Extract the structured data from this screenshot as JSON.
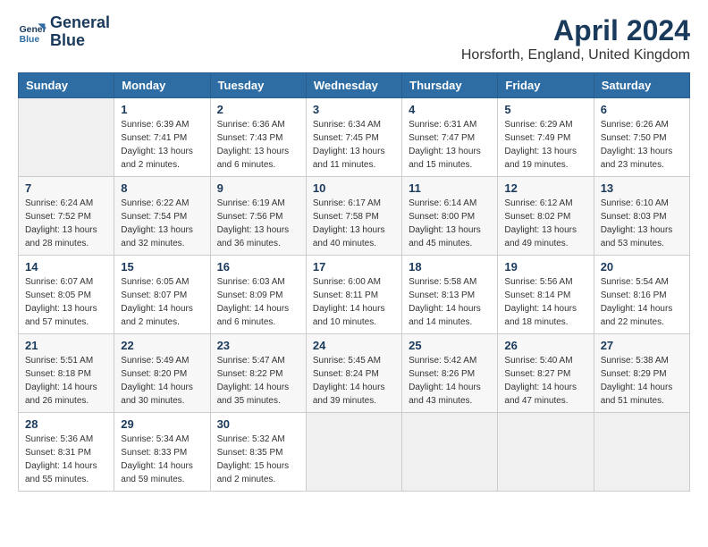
{
  "logo": {
    "line1": "General",
    "line2": "Blue"
  },
  "title": "April 2024",
  "subtitle": "Horsforth, England, United Kingdom",
  "weekdays": [
    "Sunday",
    "Monday",
    "Tuesday",
    "Wednesday",
    "Thursday",
    "Friday",
    "Saturday"
  ],
  "weeks": [
    [
      {
        "day": "",
        "sunrise": "",
        "sunset": "",
        "daylight": ""
      },
      {
        "day": "1",
        "sunrise": "Sunrise: 6:39 AM",
        "sunset": "Sunset: 7:41 PM",
        "daylight": "Daylight: 13 hours and 2 minutes."
      },
      {
        "day": "2",
        "sunrise": "Sunrise: 6:36 AM",
        "sunset": "Sunset: 7:43 PM",
        "daylight": "Daylight: 13 hours and 6 minutes."
      },
      {
        "day": "3",
        "sunrise": "Sunrise: 6:34 AM",
        "sunset": "Sunset: 7:45 PM",
        "daylight": "Daylight: 13 hours and 11 minutes."
      },
      {
        "day": "4",
        "sunrise": "Sunrise: 6:31 AM",
        "sunset": "Sunset: 7:47 PM",
        "daylight": "Daylight: 13 hours and 15 minutes."
      },
      {
        "day": "5",
        "sunrise": "Sunrise: 6:29 AM",
        "sunset": "Sunset: 7:49 PM",
        "daylight": "Daylight: 13 hours and 19 minutes."
      },
      {
        "day": "6",
        "sunrise": "Sunrise: 6:26 AM",
        "sunset": "Sunset: 7:50 PM",
        "daylight": "Daylight: 13 hours and 23 minutes."
      }
    ],
    [
      {
        "day": "7",
        "sunrise": "Sunrise: 6:24 AM",
        "sunset": "Sunset: 7:52 PM",
        "daylight": "Daylight: 13 hours and 28 minutes."
      },
      {
        "day": "8",
        "sunrise": "Sunrise: 6:22 AM",
        "sunset": "Sunset: 7:54 PM",
        "daylight": "Daylight: 13 hours and 32 minutes."
      },
      {
        "day": "9",
        "sunrise": "Sunrise: 6:19 AM",
        "sunset": "Sunset: 7:56 PM",
        "daylight": "Daylight: 13 hours and 36 minutes."
      },
      {
        "day": "10",
        "sunrise": "Sunrise: 6:17 AM",
        "sunset": "Sunset: 7:58 PM",
        "daylight": "Daylight: 13 hours and 40 minutes."
      },
      {
        "day": "11",
        "sunrise": "Sunrise: 6:14 AM",
        "sunset": "Sunset: 8:00 PM",
        "daylight": "Daylight: 13 hours and 45 minutes."
      },
      {
        "day": "12",
        "sunrise": "Sunrise: 6:12 AM",
        "sunset": "Sunset: 8:02 PM",
        "daylight": "Daylight: 13 hours and 49 minutes."
      },
      {
        "day": "13",
        "sunrise": "Sunrise: 6:10 AM",
        "sunset": "Sunset: 8:03 PM",
        "daylight": "Daylight: 13 hours and 53 minutes."
      }
    ],
    [
      {
        "day": "14",
        "sunrise": "Sunrise: 6:07 AM",
        "sunset": "Sunset: 8:05 PM",
        "daylight": "Daylight: 13 hours and 57 minutes."
      },
      {
        "day": "15",
        "sunrise": "Sunrise: 6:05 AM",
        "sunset": "Sunset: 8:07 PM",
        "daylight": "Daylight: 14 hours and 2 minutes."
      },
      {
        "day": "16",
        "sunrise": "Sunrise: 6:03 AM",
        "sunset": "Sunset: 8:09 PM",
        "daylight": "Daylight: 14 hours and 6 minutes."
      },
      {
        "day": "17",
        "sunrise": "Sunrise: 6:00 AM",
        "sunset": "Sunset: 8:11 PM",
        "daylight": "Daylight: 14 hours and 10 minutes."
      },
      {
        "day": "18",
        "sunrise": "Sunrise: 5:58 AM",
        "sunset": "Sunset: 8:13 PM",
        "daylight": "Daylight: 14 hours and 14 minutes."
      },
      {
        "day": "19",
        "sunrise": "Sunrise: 5:56 AM",
        "sunset": "Sunset: 8:14 PM",
        "daylight": "Daylight: 14 hours and 18 minutes."
      },
      {
        "day": "20",
        "sunrise": "Sunrise: 5:54 AM",
        "sunset": "Sunset: 8:16 PM",
        "daylight": "Daylight: 14 hours and 22 minutes."
      }
    ],
    [
      {
        "day": "21",
        "sunrise": "Sunrise: 5:51 AM",
        "sunset": "Sunset: 8:18 PM",
        "daylight": "Daylight: 14 hours and 26 minutes."
      },
      {
        "day": "22",
        "sunrise": "Sunrise: 5:49 AM",
        "sunset": "Sunset: 8:20 PM",
        "daylight": "Daylight: 14 hours and 30 minutes."
      },
      {
        "day": "23",
        "sunrise": "Sunrise: 5:47 AM",
        "sunset": "Sunset: 8:22 PM",
        "daylight": "Daylight: 14 hours and 35 minutes."
      },
      {
        "day": "24",
        "sunrise": "Sunrise: 5:45 AM",
        "sunset": "Sunset: 8:24 PM",
        "daylight": "Daylight: 14 hours and 39 minutes."
      },
      {
        "day": "25",
        "sunrise": "Sunrise: 5:42 AM",
        "sunset": "Sunset: 8:26 PM",
        "daylight": "Daylight: 14 hours and 43 minutes."
      },
      {
        "day": "26",
        "sunrise": "Sunrise: 5:40 AM",
        "sunset": "Sunset: 8:27 PM",
        "daylight": "Daylight: 14 hours and 47 minutes."
      },
      {
        "day": "27",
        "sunrise": "Sunrise: 5:38 AM",
        "sunset": "Sunset: 8:29 PM",
        "daylight": "Daylight: 14 hours and 51 minutes."
      }
    ],
    [
      {
        "day": "28",
        "sunrise": "Sunrise: 5:36 AM",
        "sunset": "Sunset: 8:31 PM",
        "daylight": "Daylight: 14 hours and 55 minutes."
      },
      {
        "day": "29",
        "sunrise": "Sunrise: 5:34 AM",
        "sunset": "Sunset: 8:33 PM",
        "daylight": "Daylight: 14 hours and 59 minutes."
      },
      {
        "day": "30",
        "sunrise": "Sunrise: 5:32 AM",
        "sunset": "Sunset: 8:35 PM",
        "daylight": "Daylight: 15 hours and 2 minutes."
      },
      {
        "day": "",
        "sunrise": "",
        "sunset": "",
        "daylight": ""
      },
      {
        "day": "",
        "sunrise": "",
        "sunset": "",
        "daylight": ""
      },
      {
        "day": "",
        "sunrise": "",
        "sunset": "",
        "daylight": ""
      },
      {
        "day": "",
        "sunrise": "",
        "sunset": "",
        "daylight": ""
      }
    ]
  ]
}
